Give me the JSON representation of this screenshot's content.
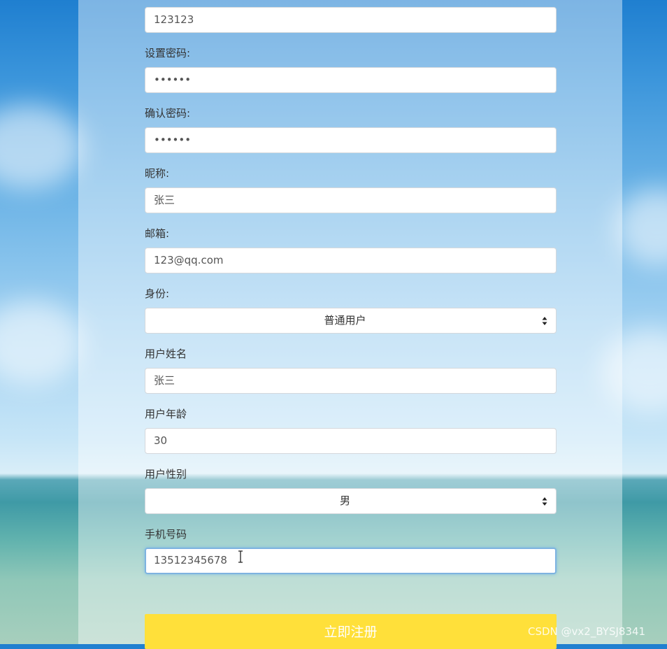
{
  "form": {
    "username_value": "123123",
    "password_label": "设置密码:",
    "password_value": "••••••",
    "confirm_label": "确认密码:",
    "confirm_value": "••••••",
    "nickname_label": "昵称:",
    "nickname_value": "张三",
    "email_label": "邮箱:",
    "email_value": "123@qq.com",
    "role_label": "身份:",
    "role_value": "普通用户",
    "name_label": "用户姓名",
    "name_value": "张三",
    "age_label": "用户年龄",
    "age_value": "30",
    "gender_label": "用户性别",
    "gender_value": "男",
    "phone_label": "手机号码",
    "phone_value": "13512345678"
  },
  "submit": {
    "label": "立即注册"
  },
  "watermark": "CSDN @vx2_BYSJ8341",
  "icons": {
    "select_arrows": "up-down-caret-icon",
    "cursor": "text-cursor-icon"
  },
  "colors": {
    "submit_bg": "#ffe03a",
    "focus_border": "#7eb3e0"
  }
}
